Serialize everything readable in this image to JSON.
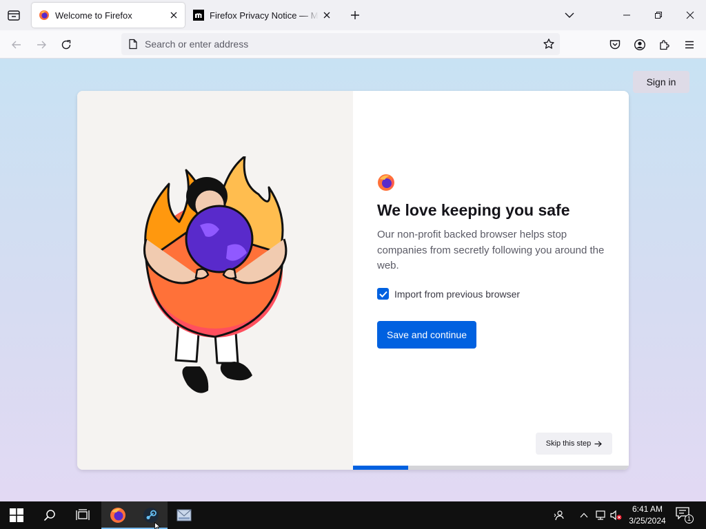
{
  "tabs": [
    {
      "title": "Welcome to Firefox",
      "active": true,
      "icon": "firefox-icon"
    },
    {
      "title": "Firefox Privacy Notice — Mozilla",
      "active": false,
      "icon": "mozilla-m-icon"
    }
  ],
  "urlbar": {
    "placeholder": "Search or enter address",
    "value": ""
  },
  "header": {
    "signin_label": "Sign in"
  },
  "onboarding": {
    "headline": "We love keeping you safe",
    "subtitle": "Our non-profit backed browser helps stop companies from secretly following you around the web.",
    "import_label": "Import from previous browser",
    "import_checked": true,
    "primary_button": "Save and continue",
    "skip_button": "Skip this step",
    "progress_fraction": 0.2
  },
  "taskbar": {
    "pinned": [
      "firefox-icon",
      "steam-icon",
      "mail-app-icon"
    ],
    "time": "6:41 AM",
    "date": "3/25/2024",
    "notification_count": "1"
  },
  "colors": {
    "accent": "#0061e0",
    "tab_strip": "#f0f0f4",
    "taskbar": "#101010"
  }
}
